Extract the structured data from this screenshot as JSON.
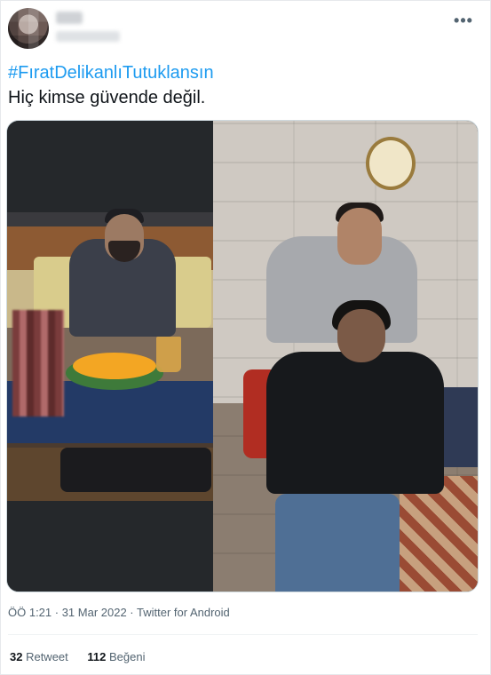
{
  "tweet": {
    "hashtag": "#FıratDelikanlıTutuklansın",
    "text": "Hiç kimse güvende değil.",
    "more_label": "•••",
    "meta": "ÖÖ 1:21 · 31 Mar 2022 · Twitter for Android",
    "retweets": {
      "count": "32",
      "label": "Retweet"
    },
    "likes": {
      "count": "112",
      "label": "Beğeni"
    }
  },
  "colors": {
    "accent": "#1d9bf0",
    "text": "#0f1419",
    "muted": "#536471"
  },
  "icons": {
    "more": "more-horizontal-icon"
  }
}
